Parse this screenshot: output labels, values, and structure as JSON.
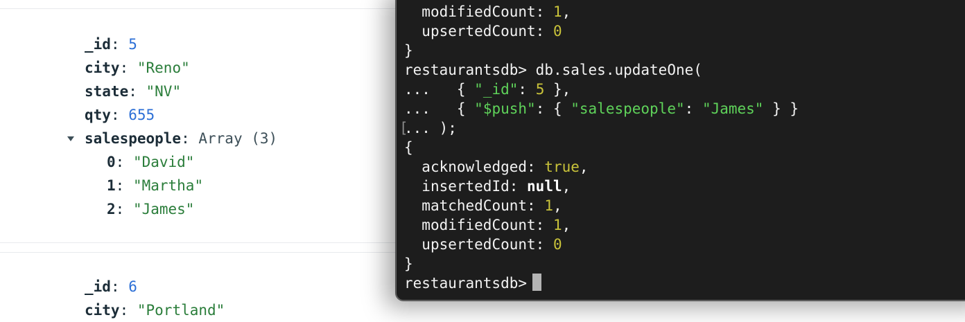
{
  "docs": [
    {
      "id_key": "_id",
      "id_value": "5",
      "city_key": "city",
      "city_value": "\"Reno\"",
      "state_key": "state",
      "state_value": "\"NV\"",
      "qty_key": "qty",
      "qty_value": "655",
      "sp_key": "salespeople",
      "sp_type": "Array (3)",
      "sp_items": [
        {
          "index": "0",
          "value": "\"David\""
        },
        {
          "index": "1",
          "value": "\"Martha\""
        },
        {
          "index": "2",
          "value": "\"James\""
        }
      ]
    },
    {
      "id_key": "_id",
      "id_value": "6",
      "city_key": "city",
      "city_value": "\"Portland\""
    }
  ],
  "terminal": {
    "prev_result": {
      "modified_key": "modifiedCount:",
      "modified_value": "1",
      "upserted_key": "upsertedCount:",
      "upserted_value": "0"
    },
    "prompt": "restaurantsdb>",
    "command": "db.sales.updateOne(",
    "continuation": "...",
    "line2": {
      "open": "{ ",
      "key": "\"_id\"",
      "colon": ": ",
      "value": "5",
      "close": " },"
    },
    "line3": {
      "open": "{ ",
      "op": "\"$push\"",
      "mid": ": { ",
      "field": "\"salespeople\"",
      "colon": ": ",
      "value": "\"James\"",
      "close": " } }"
    },
    "line4_close": " );",
    "result": {
      "acknowledged_key": "acknowledged:",
      "acknowledged_value": "true",
      "inserted_key": "insertedId:",
      "inserted_value": "null",
      "matched_key": "matchedCount:",
      "matched_value": "1",
      "modified_key": "modifiedCount:",
      "modified_value": "1",
      "upserted_key": "upsertedCount:",
      "upserted_value": "0"
    }
  }
}
